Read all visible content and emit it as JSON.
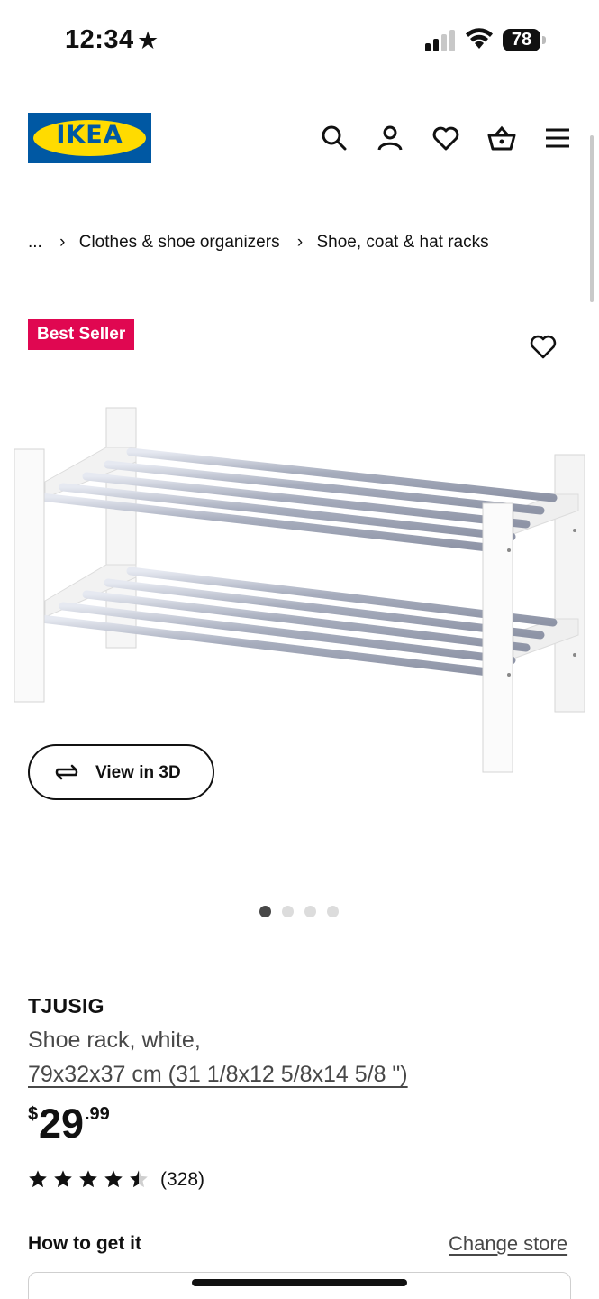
{
  "status_bar": {
    "time": "12:34",
    "battery": "78"
  },
  "header": {
    "logo_text": "IKEA",
    "icons": [
      "search-icon",
      "account-icon",
      "heart-icon",
      "cart-icon",
      "menu-icon"
    ]
  },
  "breadcrumb": {
    "ellipsis": "...",
    "items": [
      "Clothes & shoe organizers",
      "Shoe, coat & hat racks"
    ]
  },
  "badge": "Best Seller",
  "view3d_label": "View in 3D",
  "carousel": {
    "count": 4,
    "active_index": 0
  },
  "product": {
    "name": "TJUSIG",
    "description": "Shoe rack, white,",
    "dimensions": "79x32x37 cm (31 1/8x12 5/8x14 5/8 \")",
    "price_currency": "$",
    "price_integer": "29",
    "price_decimal": ".99",
    "rating_value": 4.5,
    "rating_count": "(328)"
  },
  "how_to_get_it": {
    "title": "How to get it",
    "change_store": "Change store"
  },
  "colors": {
    "ikea_blue": "#0058a3",
    "ikea_yellow": "#ffdb00",
    "badge_red": "#e00751"
  }
}
